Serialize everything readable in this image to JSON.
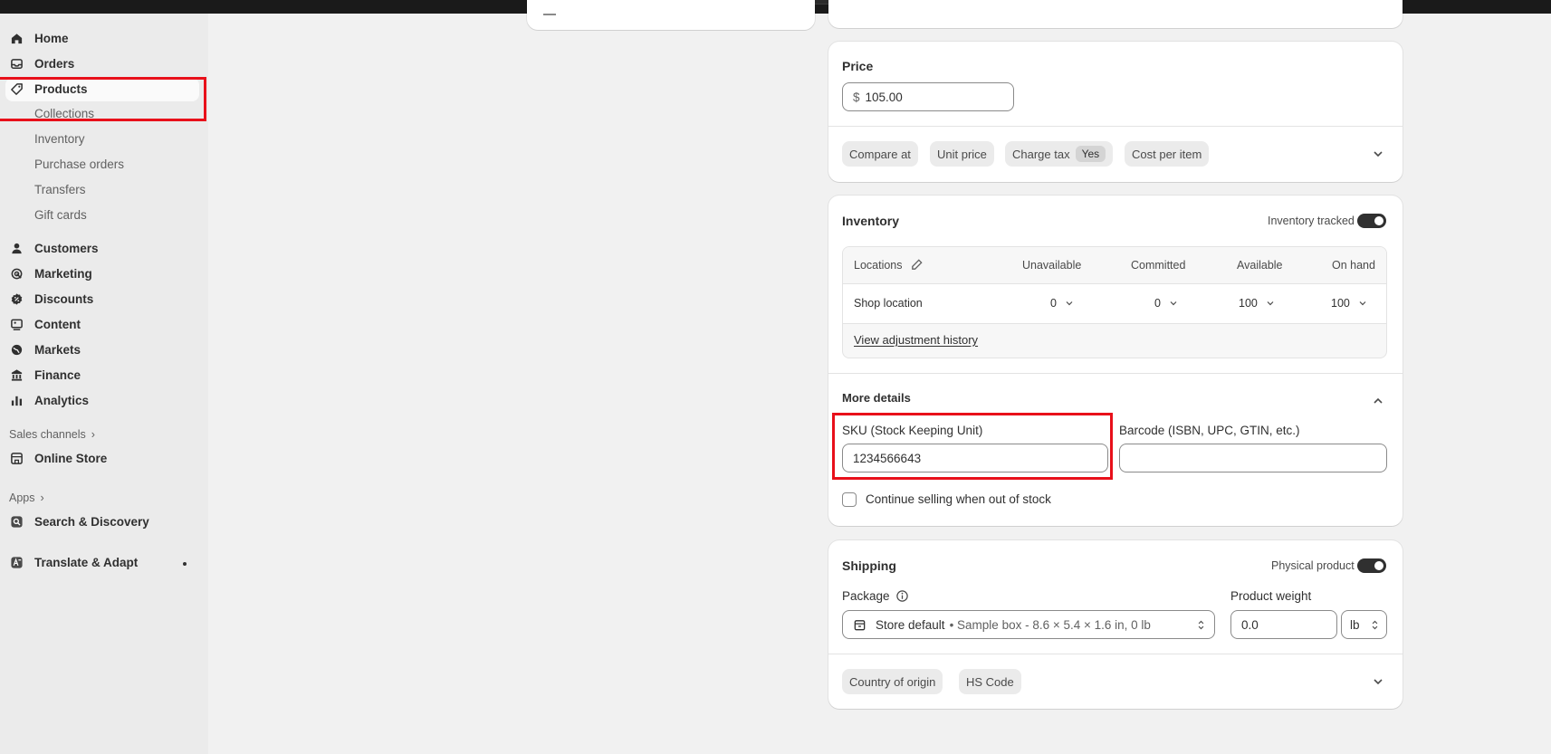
{
  "sidebar": {
    "items": [
      {
        "label": "Home",
        "icon": "home-icon"
      },
      {
        "label": "Orders",
        "icon": "inbox-icon"
      },
      {
        "label": "Products",
        "icon": "tag-icon"
      }
    ],
    "product_subitems": [
      "Collections",
      "Inventory",
      "Purchase orders",
      "Transfers",
      "Gift cards"
    ],
    "items2": [
      {
        "label": "Customers",
        "icon": "person-icon"
      },
      {
        "label": "Marketing",
        "icon": "target-icon"
      },
      {
        "label": "Discounts",
        "icon": "discount-icon"
      },
      {
        "label": "Content",
        "icon": "content-icon"
      },
      {
        "label": "Markets",
        "icon": "globe-icon"
      },
      {
        "label": "Finance",
        "icon": "bank-icon"
      },
      {
        "label": "Analytics",
        "icon": "bar-chart-icon"
      }
    ],
    "sales_channels_label": "Sales channels",
    "online_store": "Online Store",
    "apps_label": "Apps",
    "search_discovery": "Search & Discovery",
    "translate_adapt": "Translate & Adapt"
  },
  "price": {
    "title": "Price",
    "currency": "$",
    "value": "105.00",
    "chips": {
      "compare_at": "Compare at",
      "unit_price": "Unit price",
      "charge_tax": "Charge tax",
      "charge_tax_value": "Yes",
      "cost_per_item": "Cost per item"
    }
  },
  "inventory": {
    "title": "Inventory",
    "tracked_label": "Inventory tracked",
    "tracked": true,
    "columns": [
      "Locations",
      "Unavailable",
      "Committed",
      "Available",
      "On hand"
    ],
    "row": {
      "location": "Shop location",
      "unavailable": "0",
      "committed": "0",
      "available": "100",
      "on_hand": "100"
    },
    "history_link": "View adjustment history"
  },
  "more_details": {
    "title": "More details",
    "sku_label": "SKU (Stock Keeping Unit)",
    "sku_value": "1234566643",
    "barcode_label": "Barcode (ISBN, UPC, GTIN, etc.)",
    "barcode_value": "",
    "continue_selling": "Continue selling when out of stock",
    "continue_selling_checked": false
  },
  "shipping": {
    "title": "Shipping",
    "physical_label": "Physical product",
    "physical": true,
    "package_label": "Package",
    "package_name": "Store default",
    "package_detail": "• Sample box - 8.6 × 5.4 × 1.6 in, 0 lb",
    "weight_label": "Product weight",
    "weight_value": "0.0",
    "weight_unit": "lb",
    "chips": {
      "country": "Country of origin",
      "hs_code": "HS Code"
    }
  },
  "colors": {
    "highlight": "#e8101a",
    "toggle_on": "#303030"
  }
}
